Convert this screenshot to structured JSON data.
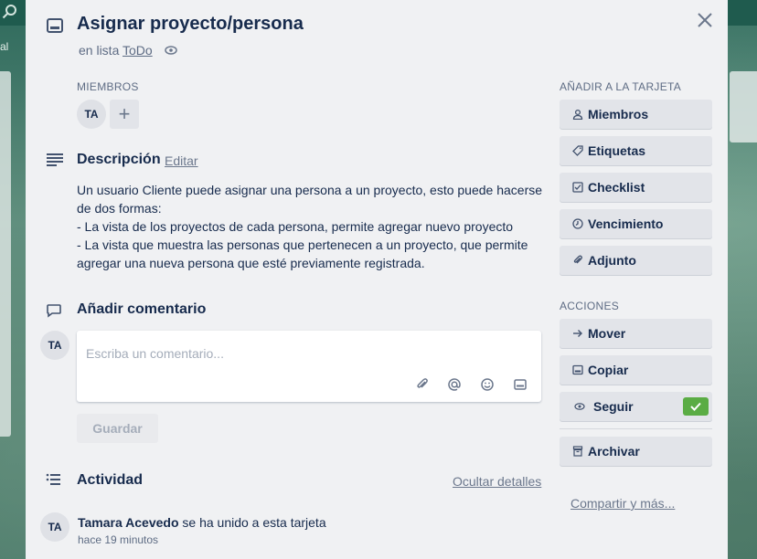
{
  "card": {
    "title": "Asignar proyecto/persona",
    "in_list_prefix": "en lista",
    "list_name": "ToDo"
  },
  "members": {
    "label": "MIEMBROS",
    "avatars": [
      "TA"
    ],
    "add_symbol": "+"
  },
  "description": {
    "title": "Descripción",
    "edit_label": "Editar",
    "lines": [
      "Un usuario Cliente puede asignar una persona a un proyecto, esto puede hacerse de dos formas:",
      "- La vista de los proyectos de cada persona, permite agregar nuevo proyecto",
      "- La vista que muestra las personas que pertenecen a un proyecto, que permite agregar una nueva persona que esté previamente registrada."
    ]
  },
  "comment": {
    "title": "Añadir comentario",
    "avatar": "TA",
    "placeholder": "Escriba un comentario...",
    "save_label": "Guardar"
  },
  "activity": {
    "title": "Actividad",
    "toggle_label": "Ocultar detalles",
    "items": [
      {
        "avatar": "TA",
        "user": "Tamara Acevedo",
        "action": "se ha unido a esta tarjeta",
        "time": "hace 19 minutos"
      }
    ]
  },
  "sidebar": {
    "add_label": "AÑADIR A LA TARJETA",
    "add_buttons": [
      "Miembros",
      "Etiquetas",
      "Checklist",
      "Vencimiento",
      "Adjunto"
    ],
    "actions_label": "ACCIONES",
    "action_buttons": [
      "Mover",
      "Copiar",
      "Seguir",
      "Archivar"
    ],
    "share_label": "Compartir y más..."
  },
  "colors": {
    "modal_bg": "#f0f1f3",
    "button_bg": "#e2e4e9",
    "watch_check": "#5aac44",
    "board_bg": "#3f6f60"
  },
  "background": {
    "left_fragment": "al"
  }
}
